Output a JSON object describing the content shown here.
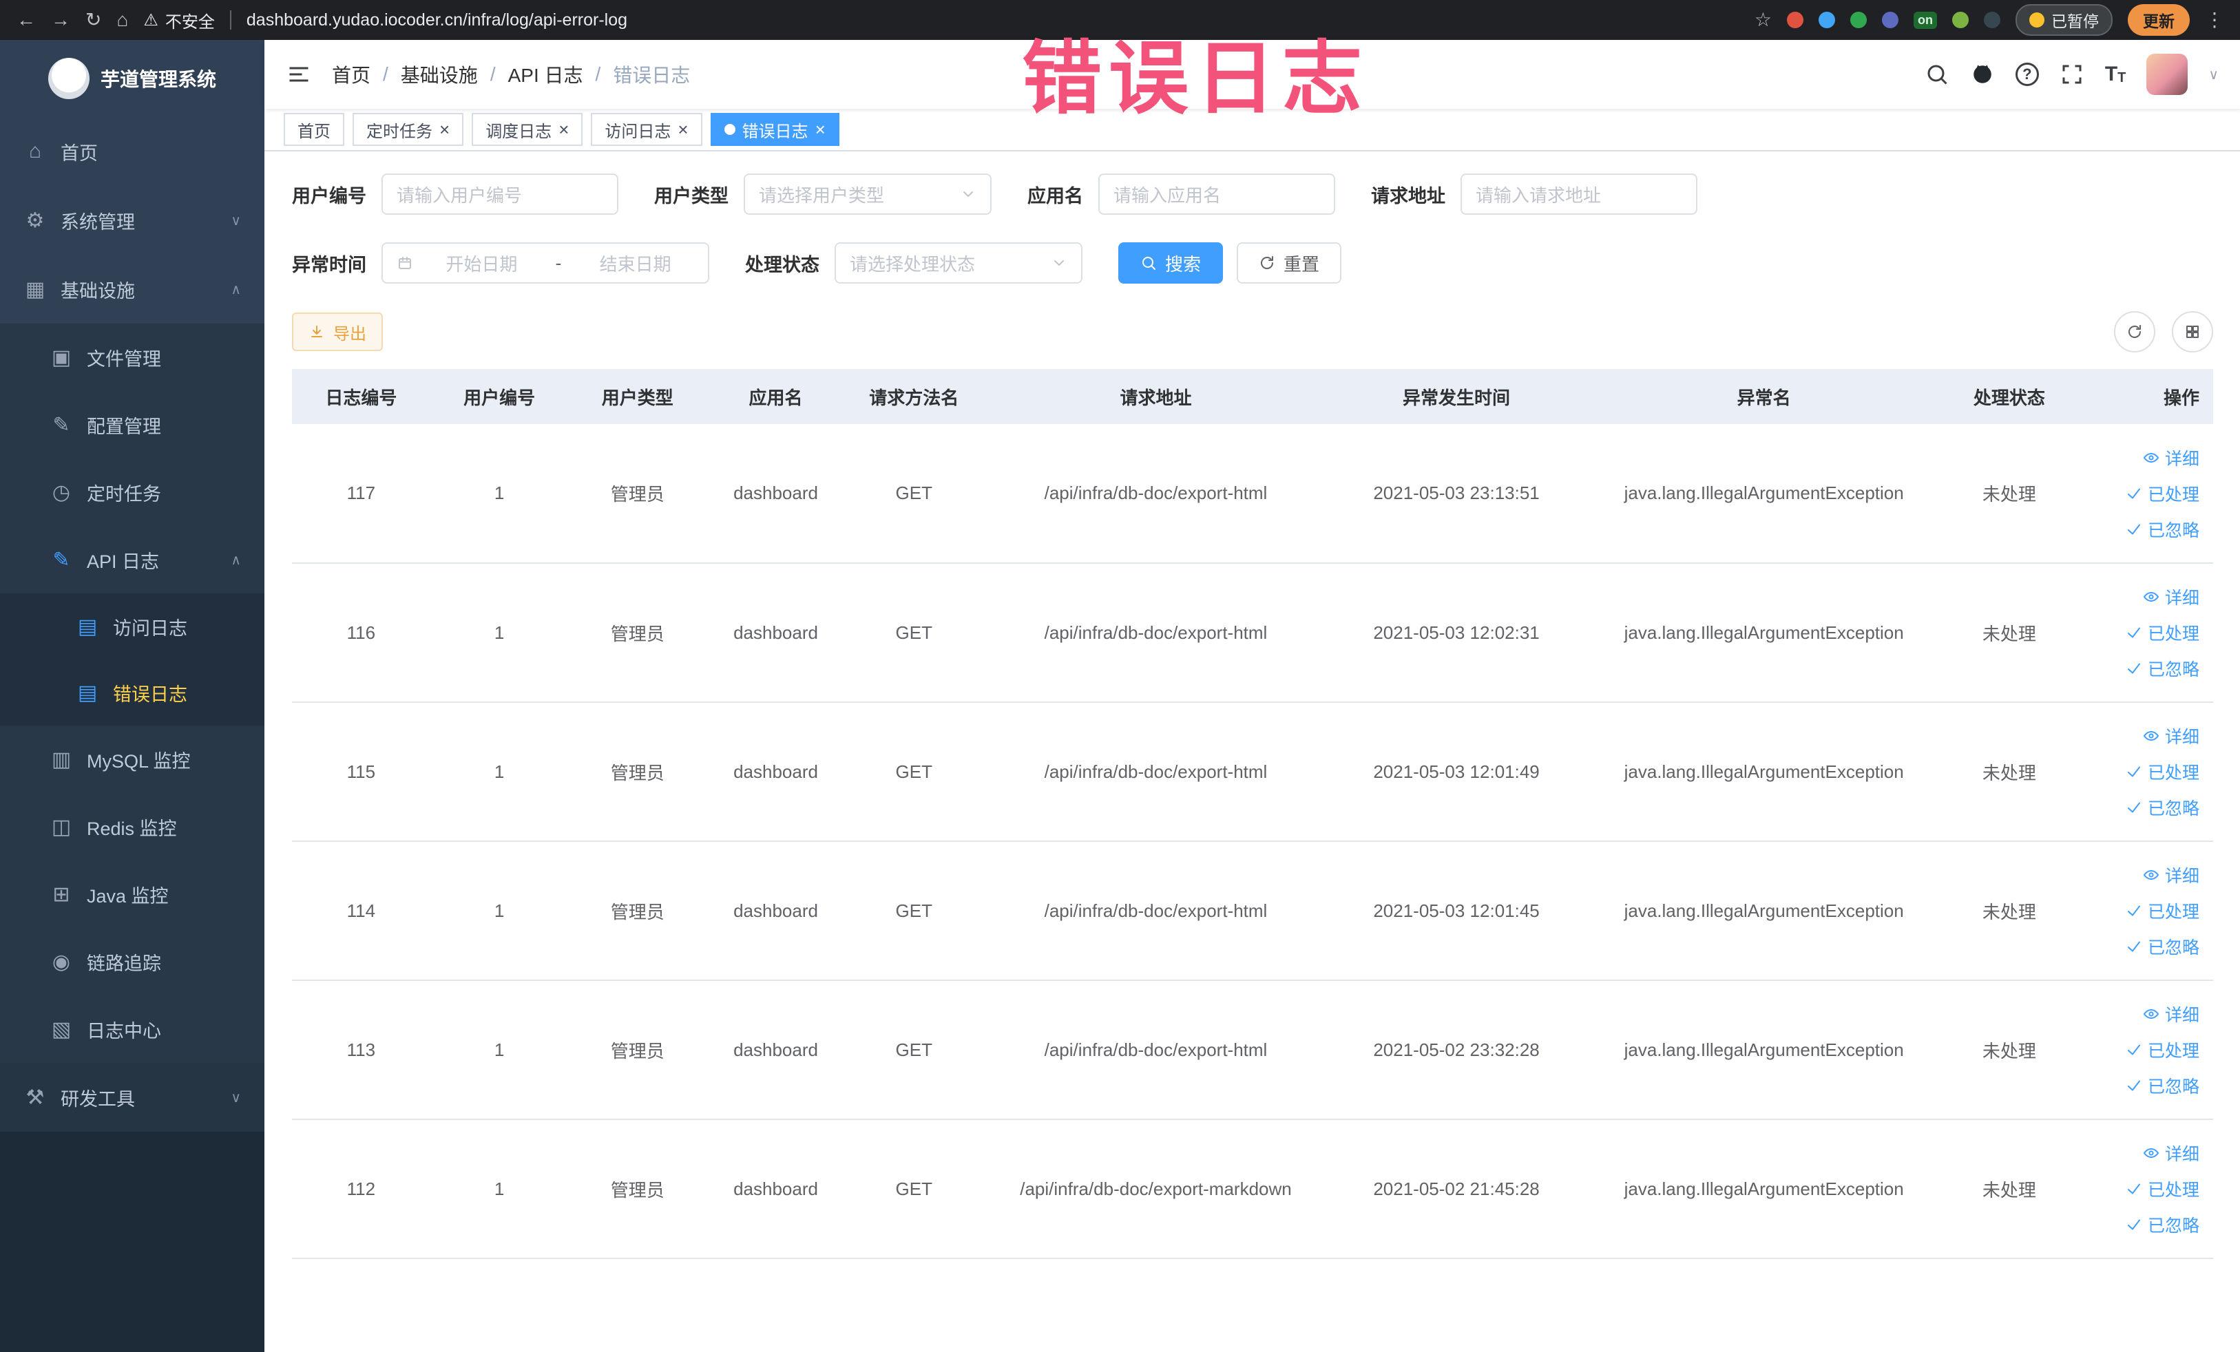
{
  "watermark": "错误日志",
  "browser": {
    "security": "不安全",
    "url": "dashboard.yudao.iocoder.cn/infra/log/api-error-log",
    "paused": "已暂停",
    "update": "更新",
    "ext_on": "on"
  },
  "icons": {
    "back": "←",
    "forward": "→",
    "reload": "↻",
    "chromehome": "⌂",
    "warn": "⚠",
    "star": "☆",
    "dots": "⋮",
    "home": "⌂",
    "gear": "⚙",
    "infra": "▦",
    "file": "▣",
    "config": "✎",
    "cron": "◷",
    "api": "✎",
    "log": "▤",
    "mysql": "▥",
    "redis": "◫",
    "java": "⊞",
    "trace": "◉",
    "logcenter": "▧",
    "tools": "⚒",
    "caret_down": "∨",
    "caret_up": "∧",
    "close": "×",
    "separator": "/",
    "question": "?",
    "fontsize": "T"
  },
  "sidebar": {
    "title": "芋道管理系统",
    "items": [
      "首页",
      "系统管理",
      "基础设施",
      "文件管理",
      "配置管理",
      "定时任务",
      "API 日志",
      "访问日志",
      "错误日志",
      "MySQL 监控",
      "Redis 监控",
      "Java 监控",
      "链路追踪",
      "日志中心",
      "研发工具"
    ]
  },
  "breadcrumb": [
    "首页",
    "基础设施",
    "API 日志",
    "错误日志"
  ],
  "tabs": [
    {
      "label": "首页"
    },
    {
      "label": "定时任务"
    },
    {
      "label": "调度日志"
    },
    {
      "label": "访问日志"
    },
    {
      "label": "错误日志"
    }
  ],
  "filters": {
    "user_id_label": "用户编号",
    "user_id_placeholder": "请输入用户编号",
    "user_type_label": "用户类型",
    "user_type_placeholder": "请选择用户类型",
    "app_name_label": "应用名",
    "app_name_placeholder": "请输入应用名",
    "request_url_label": "请求地址",
    "request_url_placeholder": "请输入请求地址",
    "time_label": "异常时间",
    "time_start_placeholder": "开始日期",
    "time_separator": "-",
    "time_end_placeholder": "结束日期",
    "status_label": "处理状态",
    "status_placeholder": "请选择处理状态",
    "search_label": "搜索",
    "reset_label": "重置"
  },
  "toolbar": {
    "export_label": "导出"
  },
  "table": {
    "headers": [
      "日志编号",
      "用户编号",
      "用户类型",
      "应用名",
      "请求方法名",
      "请求地址",
      "异常发生时间",
      "异常名",
      "处理状态",
      "操作"
    ],
    "action_labels": [
      "详细",
      "已处理",
      "已忽略"
    ],
    "rows": [
      {
        "id": "117",
        "user_id": "1",
        "user_type": "管理员",
        "app_name": "dashboard",
        "method": "GET",
        "url": "/api/infra/db-doc/export-html",
        "time": "2021-05-03 23:13:51",
        "exception": "java.lang.IllegalArgumentException",
        "status": "未处理"
      },
      {
        "id": "116",
        "user_id": "1",
        "user_type": "管理员",
        "app_name": "dashboard",
        "method": "GET",
        "url": "/api/infra/db-doc/export-html",
        "time": "2021-05-03 12:02:31",
        "exception": "java.lang.IllegalArgumentException",
        "status": "未处理"
      },
      {
        "id": "115",
        "user_id": "1",
        "user_type": "管理员",
        "app_name": "dashboard",
        "method": "GET",
        "url": "/api/infra/db-doc/export-html",
        "time": "2021-05-03 12:01:49",
        "exception": "java.lang.IllegalArgumentException",
        "status": "未处理"
      },
      {
        "id": "114",
        "user_id": "1",
        "user_type": "管理员",
        "app_name": "dashboard",
        "method": "GET",
        "url": "/api/infra/db-doc/export-html",
        "time": "2021-05-03 12:01:45",
        "exception": "java.lang.IllegalArgumentException",
        "status": "未处理"
      },
      {
        "id": "113",
        "user_id": "1",
        "user_type": "管理员",
        "app_name": "dashboard",
        "method": "GET",
        "url": "/api/infra/db-doc/export-html",
        "time": "2021-05-02 23:32:28",
        "exception": "java.lang.IllegalArgumentException",
        "status": "未处理"
      },
      {
        "id": "112",
        "user_id": "1",
        "user_type": "管理员",
        "app_name": "dashboard",
        "method": "GET",
        "url": "/api/infra/db-doc/export-markdown",
        "time": "2021-05-02 21:45:28",
        "exception": "java.lang.IllegalArgumentException",
        "status": "未处理"
      }
    ]
  },
  "colors": {
    "accent": "#409EFF",
    "active_menu": "#ffd04b",
    "warning": "#e6a23c",
    "watermark": "#f3537a"
  }
}
